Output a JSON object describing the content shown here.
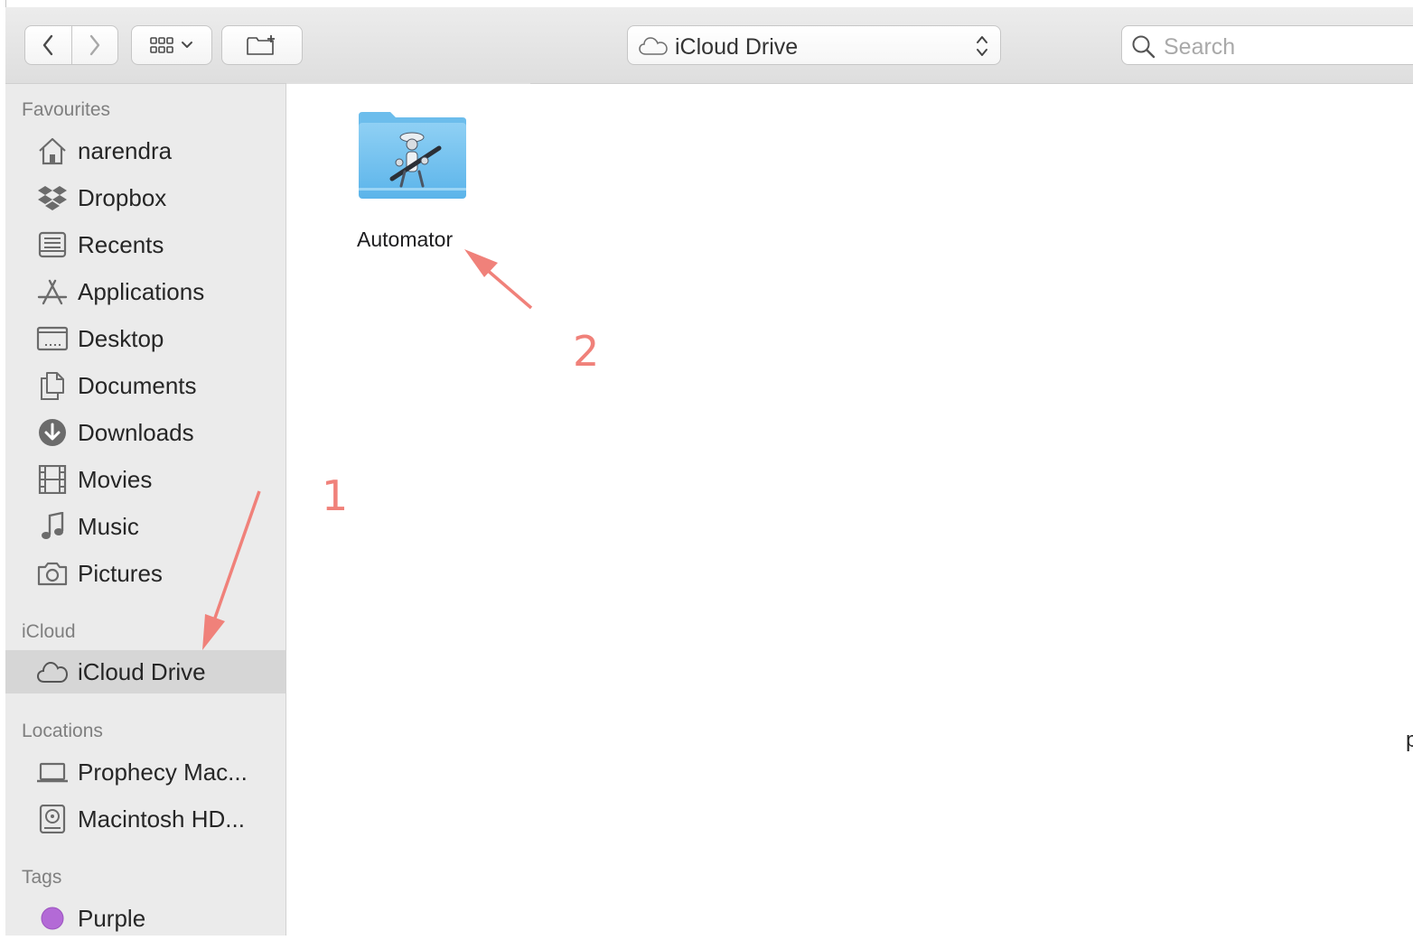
{
  "toolbar": {
    "location": "iCloud Drive",
    "search_placeholder": "Search"
  },
  "sidebar": {
    "sections": [
      {
        "heading": "Favourites"
      },
      {
        "heading": "iCloud"
      },
      {
        "heading": "Locations"
      },
      {
        "heading": "Tags"
      }
    ],
    "favourites": [
      {
        "label": "narendra",
        "icon": "home-icon"
      },
      {
        "label": "Dropbox",
        "icon": "dropbox-icon"
      },
      {
        "label": "Recents",
        "icon": "recents-icon"
      },
      {
        "label": "Applications",
        "icon": "applications-icon"
      },
      {
        "label": "Desktop",
        "icon": "desktop-icon"
      },
      {
        "label": "Documents",
        "icon": "documents-icon"
      },
      {
        "label": "Downloads",
        "icon": "downloads-icon"
      },
      {
        "label": "Movies",
        "icon": "movies-icon"
      },
      {
        "label": "Music",
        "icon": "music-icon"
      },
      {
        "label": "Pictures",
        "icon": "pictures-icon"
      }
    ],
    "icloud": [
      {
        "label": "iCloud Drive",
        "icon": "cloud-icon",
        "selected": true
      }
    ],
    "locations": [
      {
        "label": "Prophecy Mac...",
        "icon": "laptop-icon"
      },
      {
        "label": "Macintosh HD...",
        "icon": "hard-disk-icon"
      }
    ],
    "tags": [
      {
        "label": "Purple",
        "color": "#b36ad6"
      }
    ]
  },
  "content": {
    "items": [
      {
        "name": "Automator",
        "icon": "automator-folder-icon"
      }
    ]
  },
  "annotations": [
    {
      "label": "1",
      "color": "#f0817a"
    },
    {
      "label": "2",
      "color": "#f0817a"
    }
  ],
  "edge_fragment": "p"
}
